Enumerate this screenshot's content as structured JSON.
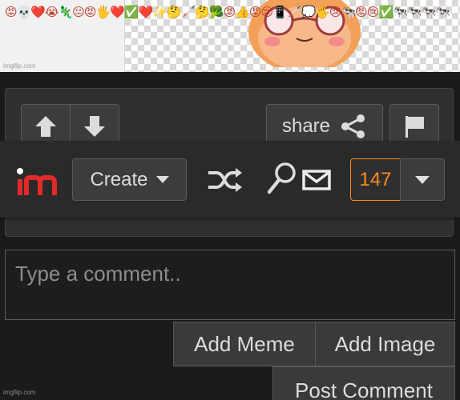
{
  "meme": {
    "caption": "😡💀❤️😭🦎😐😡🖐❤️✅❤️✨🤔🦯🤔🥦😡👍😡😢📱🦯💭🖐😢🐄😡😢✅🐄🐄🐄🐄",
    "watermark_top": "imgflip.com",
    "watermark_bottom": "imgflip.com"
  },
  "post_actions": {
    "upvote_icon": "arrow-up-icon",
    "downvote_icon": "arrow-down-icon",
    "share_label": "share",
    "share_icon": "share-icon",
    "flag_icon": "flag-icon"
  },
  "navbar": {
    "logo_text": "im",
    "create_label": "Create",
    "shuffle_icon": "shuffle-icon",
    "search_icon": "search-icon",
    "mail_icon": "mail-icon",
    "notification_count": "147",
    "accent_color": "#ff8a1e",
    "logo_color": "#e32a2a"
  },
  "comment": {
    "placeholder": "Type a comment..",
    "add_meme_label": "Add Meme",
    "add_image_label": "Add Image",
    "post_comment_label": "Post Comment"
  }
}
